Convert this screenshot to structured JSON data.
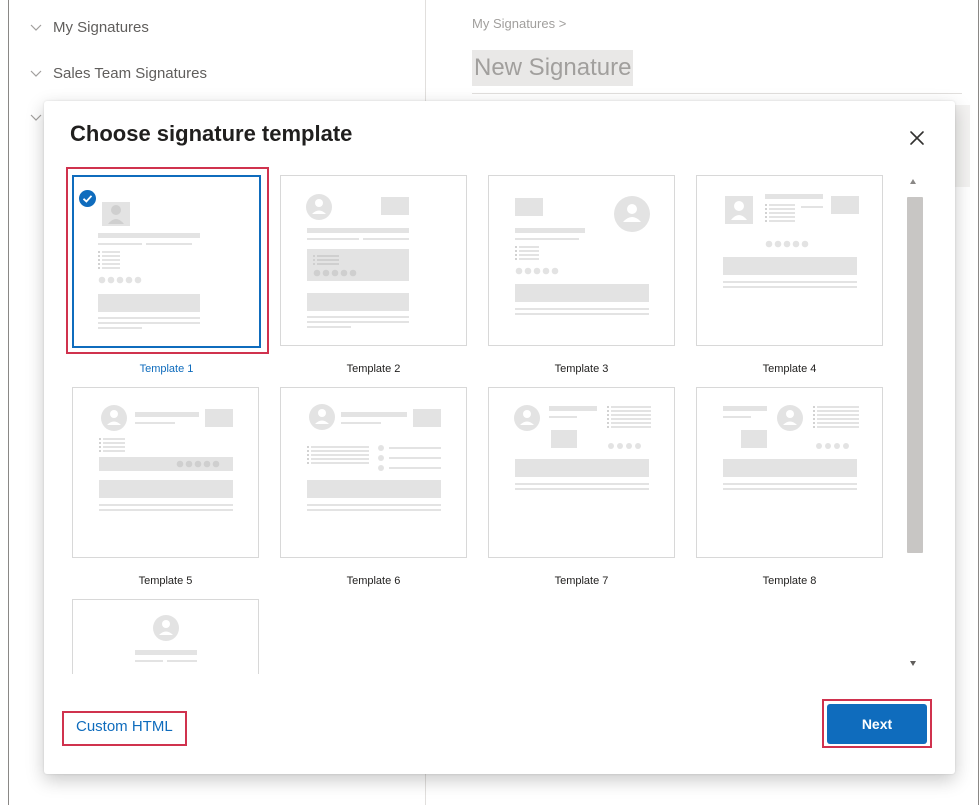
{
  "sidebar": {
    "items": [
      {
        "label": "My Signatures"
      },
      {
        "label": "Sales Team Signatures"
      }
    ]
  },
  "editor": {
    "breadcrumb": "My Signatures >",
    "title": "New Signature"
  },
  "dialog": {
    "title": "Choose signature template",
    "templates": [
      {
        "label": "Template 1",
        "selected": true
      },
      {
        "label": "Template 2",
        "selected": false
      },
      {
        "label": "Template 3",
        "selected": false
      },
      {
        "label": "Template 4",
        "selected": false
      },
      {
        "label": "Template 5",
        "selected": false
      },
      {
        "label": "Template 6",
        "selected": false
      },
      {
        "label": "Template 7",
        "selected": false
      },
      {
        "label": "Template 8",
        "selected": false
      }
    ],
    "custom_html_label": "Custom HTML",
    "next_label": "Next"
  },
  "colors": {
    "accent": "#0f6cbd",
    "highlight": "#d0324e",
    "placeholder": "#e3e3e3"
  }
}
